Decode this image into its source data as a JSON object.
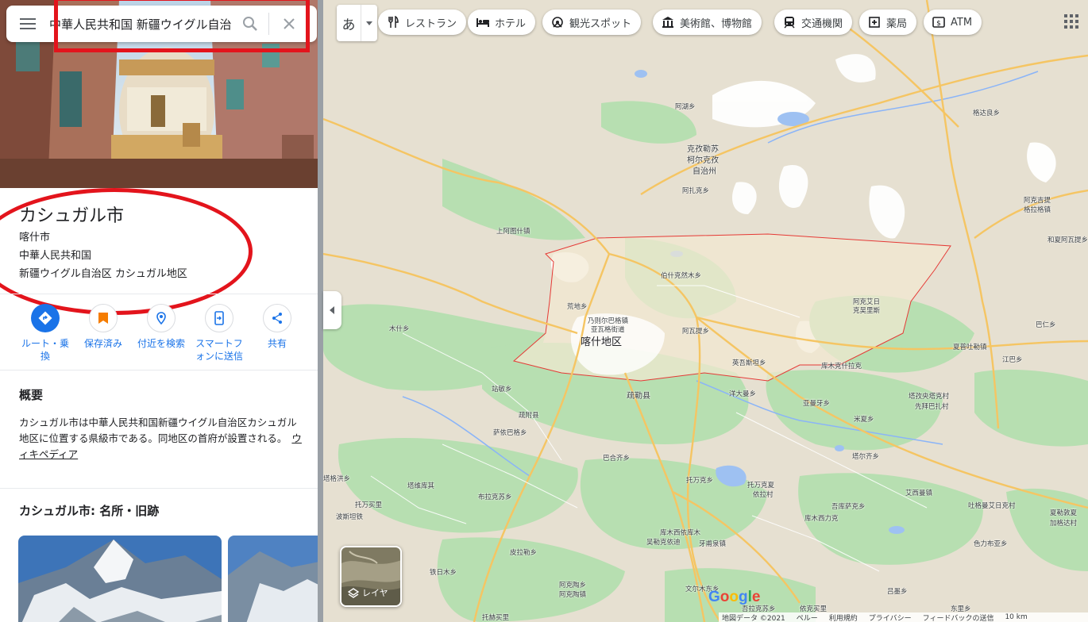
{
  "search": {
    "value": "中華人民共和国 新疆ウイグル自治区 カシュガル地区 カシュガル市"
  },
  "place": {
    "title": "カシュガル市",
    "local_name": "喀什市",
    "country": "中華人民共和国",
    "region": "新疆ウイグル自治区 カシュガル地区"
  },
  "actions": [
    {
      "label": "ルート・乗換",
      "icon": "directions-icon"
    },
    {
      "label": "保存済み",
      "icon": "bookmark-icon"
    },
    {
      "label": "付近を検索",
      "icon": "nearby-icon"
    },
    {
      "label": "スマートフォンに送信",
      "icon": "send-to-phone-icon"
    },
    {
      "label": "共有",
      "icon": "share-icon"
    }
  ],
  "overview": {
    "title": "概要",
    "text": "カシュガル市は中華人民共和国新疆ウイグル自治区カシュガル地区に位置する県級市である。同地区の首府が設置される。",
    "link": "ウィキペディア"
  },
  "sights": {
    "title": "カシュガル市: 名所・旧跡"
  },
  "map_toolbar": {
    "lang": "あ",
    "chips": [
      {
        "label": "レストラン",
        "icon": "restaurant-icon"
      },
      {
        "label": "ホテル",
        "icon": "hotel-icon"
      },
      {
        "label": "観光スポット",
        "icon": "attraction-icon"
      },
      {
        "label": "美術館、博物館",
        "icon": "museum-icon"
      },
      {
        "label": "交通機関",
        "icon": "transit-icon"
      },
      {
        "label": "薬局",
        "icon": "pharmacy-icon"
      },
      {
        "label": "ATM",
        "icon": "atm-icon"
      }
    ]
  },
  "map": {
    "layer_label": "レイヤ",
    "logo": "Google",
    "labels": {
      "kashgar_area": "喀什地区",
      "kizilsu_1": "克孜勒苏",
      "kizilsu_2": "柯尔克孜",
      "kizilsu_3": "自治州",
      "ayidun": "阿湖乡",
      "gedaliang": "格达良乡",
      "azake": "阿扎克乡",
      "shangatu": "上阿图什镇",
      "akejiti": "阿克吉提",
      "xianghedong": "格拉格镇",
      "heyan": "和夏阿瓦提乡",
      "bokeqieke": "伯什克然木乡",
      "huangdi": "荒地乡",
      "naizerbag_1": "乃则尔巴格镇",
      "naizerbag_2": "亚瓦格街道",
      "awati": "阿瓦提乡",
      "akeyi_1": "阿克艾日",
      "akeyi_2": "克吴里斯",
      "muxi": "木什乡",
      "xiaoergai": "夏普吐勒镇",
      "jiangbaer": "江巴乡",
      "bareke": "巴仁乡",
      "yingwusheng": "英吾斯坦乡",
      "kumuxi": "库木克什拉克",
      "zhanmin": "站敏乡",
      "shufu": "疏勒县",
      "yangdaman": "洋大曼乡",
      "yamaiya": "亚曼牙乡",
      "tazike_1": "塔孜央塔克村",
      "tazike_2": "先拜巴扎村",
      "mixia": "米夏乡",
      "shufu_county": "疏附县",
      "saiyibag": "萨依巴格乡",
      "bahesiqi": "巴合齐乡",
      "taerqi": "塔尔齐乡",
      "tagerixi": "塔格洪乡",
      "tuofa": "托万克夏",
      "yilu": "依拉村",
      "taweikuqi": "塔维库其",
      "tuozhao": "托万克乡",
      "bolong": "布拉克苏乡",
      "tuoziyou": "托万买里",
      "bolazhuan": "波斯坦铁",
      "yengi": "吾库萨克乡",
      "kumusibag": "库木西力克",
      "aiximen": "艾西曼镇",
      "tugelike": "吐格曼艾日克村",
      "kaman": "夏勒敦夏",
      "jialiu": "加格达村",
      "kumuxibag_1": "库木西依库木",
      "kumuxibag_2": "吴勒克依迪",
      "yakesu": "牙甫泉镇",
      "sebitu": "色力布亚乡",
      "pilazhan": "皮拉勒乡",
      "tiebuman": "铁日木乡",
      "akekum_1": "阿克陶乡",
      "akekum_2": "阿克陶镇",
      "wenbai": "文尔木东乡",
      "lema": "吕墨乡",
      "baihe": "吾拉克苏乡",
      "dongli": "东里乡",
      "yikemaili": "依克买里",
      "tuokebai": "托赫买里"
    },
    "footer": {
      "data": "地図データ ©2021",
      "country": "ペルー",
      "terms": "利用規約",
      "privacy": "プライバシー",
      "feedback": "フィードバックの送信",
      "scale": "10 km"
    }
  },
  "colors": {
    "accent": "#1a73e8",
    "bookmark": "#f57c00",
    "highlight_red": "#e3141c",
    "map_bg": "#e8e3d4",
    "green": "#b7dfb1",
    "road": "#f7d27a"
  }
}
